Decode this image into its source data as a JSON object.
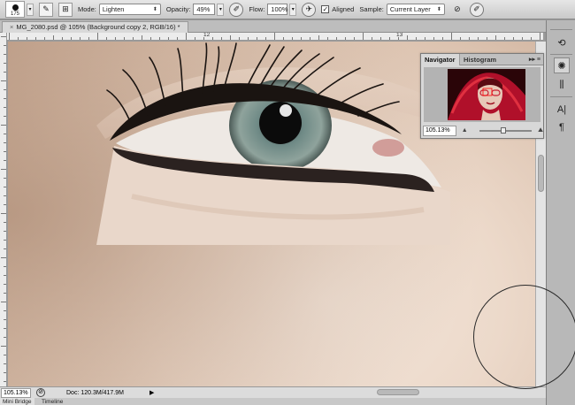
{
  "options_bar": {
    "brush_size": "175",
    "mode_label": "Mode:",
    "mode_value": "Lighten",
    "opacity_label": "Opacity:",
    "opacity_value": "49%",
    "flow_label": "Flow:",
    "flow_value": "100%",
    "aligned_label": "Aligned",
    "aligned_checked": true,
    "sample_label": "Sample:",
    "sample_value": "Current Layer"
  },
  "document": {
    "tab_title": "MG_2080.psd @ 105% (Background copy 2, RGB/16) *",
    "ruler_marks": [
      "12",
      "13"
    ]
  },
  "navigator": {
    "tabs": [
      "Navigator",
      "Histogram"
    ],
    "active_tab": "Navigator",
    "zoom_value": "105.13%",
    "zoom_slider_fraction": 0.45
  },
  "status_bar": {
    "zoom_value": "105.13%",
    "doc_info": "Doc: 120.3M/417.9M"
  },
  "bottom_tabs": [
    "Mini Bridge",
    "Timeline"
  ],
  "colors": {
    "skin": "#ecd9ca",
    "iris": "#6f8a86",
    "thumb_red": "#b0102a"
  },
  "icons": {
    "clone-stamp": "stamp-icon",
    "toggle-panel": "clone-source-icon",
    "pressure-opacity": "pressure-icon",
    "ignore-adjustment": "adjustment-icon",
    "pressure-size": "pressure-size-icon"
  }
}
